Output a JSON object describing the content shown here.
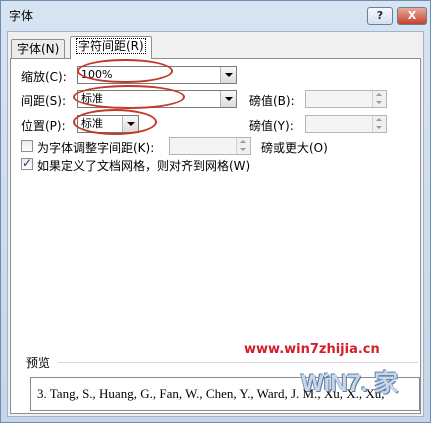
{
  "window": {
    "title": "字体",
    "help_label": "?",
    "close_label": "X"
  },
  "tabs": [
    {
      "label": "字体(N)"
    },
    {
      "label": "字符间距(R)"
    }
  ],
  "scale": {
    "label": "缩放(C):",
    "value": "100%"
  },
  "spacing": {
    "label": "间距(S):",
    "value": "标准",
    "by_label": "磅值(B):",
    "by_value": ""
  },
  "position": {
    "label": "位置(P):",
    "value": "标准",
    "by_label": "磅值(Y):",
    "by_value": ""
  },
  "kerning": {
    "label": "为字体调整字间距(K):",
    "value": "",
    "suffix": "磅或更大(O)",
    "checked": false
  },
  "grid": {
    "label": "如果定义了文档网格，则对齐到网格(W)",
    "checked": true
  },
  "preview": {
    "label": "预览",
    "text": "3. Tang, S., Huang, G., Fan, W., Chen, Y., Ward, J. M., Xu, X., Xu,"
  },
  "watermark": {
    "url": "www.win7zhijia.cn",
    "logo": "WiN7.  家"
  },
  "colors": {
    "annotation": "#c0392b",
    "watermark_red": "#d21f2b"
  }
}
